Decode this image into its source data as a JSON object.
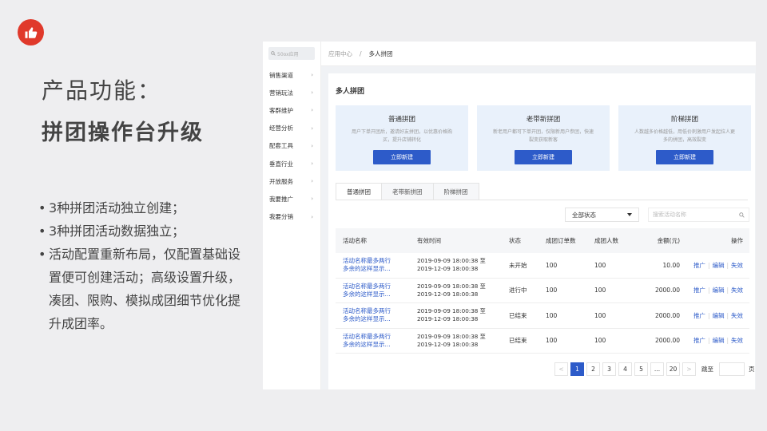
{
  "slide": {
    "title_line1": "产品功能：",
    "title_line2": "拼团操作台升级",
    "bullets": [
      "3种拼团活动独立创建；",
      "3种拼团活动数据独立；",
      "活动配置重新布局，仅配置基础设置便可创建活动；高级设置升级，凑团、限购、模拟成团细节优化提升成团率。"
    ]
  },
  "sidebar": {
    "search_placeholder": "50ox应用",
    "items": [
      "销售渠道",
      "营销玩法",
      "客群维护",
      "经营分析",
      "配套工具",
      "垂直行业",
      "开放服务",
      "我要推广",
      "我要分销"
    ]
  },
  "breadcrumb": {
    "parent": "应用中心",
    "separator": "/",
    "current": "多人拼团"
  },
  "page_title": "多人拼团",
  "cards": [
    {
      "title": "普通拼团",
      "desc": "用户下单开团后，邀请好友拼团，以优惠价格购买，提升店铺转化",
      "button": "立即新建"
    },
    {
      "title": "老带新拼团",
      "desc": "新老用户都可下单开团，仅限新用户参团，快速裂变获取新客",
      "button": "立即新建"
    },
    {
      "title": "阶梯拼团",
      "desc": "人数越多价格越低，用低价刺激用户发起拉人更多的拼团，高效裂变",
      "button": "立即新建"
    }
  ],
  "tabs": [
    "普通拼团",
    "老带新拼团",
    "阶梯拼团"
  ],
  "filters": {
    "status_value": "全部状态",
    "search_placeholder": "搜索活动名称"
  },
  "table": {
    "headers": [
      "活动名称",
      "有效时间",
      "状态",
      "成团订单数",
      "成团人数",
      "金额(元)",
      "操作"
    ],
    "rows": [
      {
        "name1": "活动名称最多两行",
        "name2": "多余的这样显示...",
        "time1": "2019-09-09 18:00:38 至",
        "time2": "2019-12-09 18:00:38",
        "status": "未开始",
        "orders": "100",
        "people": "100",
        "amount": "10.00"
      },
      {
        "name1": "活动名称最多两行",
        "name2": "多余的这样显示...",
        "time1": "2019-09-09 18:00:38 至",
        "time2": "2019-12-09 18:00:38",
        "status": "进行中",
        "orders": "100",
        "people": "100",
        "amount": "2000.00"
      },
      {
        "name1": "活动名称最多两行",
        "name2": "多余的这样显示...",
        "time1": "2019-09-09 18:00:38 至",
        "time2": "2019-12-09 18:00:38",
        "status": "已结束",
        "orders": "100",
        "people": "100",
        "amount": "2000.00"
      },
      {
        "name1": "活动名称最多两行",
        "name2": "多余的这样显示...",
        "time1": "2019-09-09 18:00:38 至",
        "time2": "2019-12-09 18:00:38",
        "status": "已结束",
        "orders": "100",
        "people": "100",
        "amount": "2000.00"
      }
    ],
    "ops": [
      "推广",
      "编辑",
      "失效"
    ],
    "op_separator": "|"
  },
  "pagination": {
    "prev": "<",
    "pages": [
      "1",
      "2",
      "3",
      "4",
      "5",
      "...",
      "20"
    ],
    "next": ">",
    "jump_label": "跳至",
    "page_unit": "页"
  }
}
